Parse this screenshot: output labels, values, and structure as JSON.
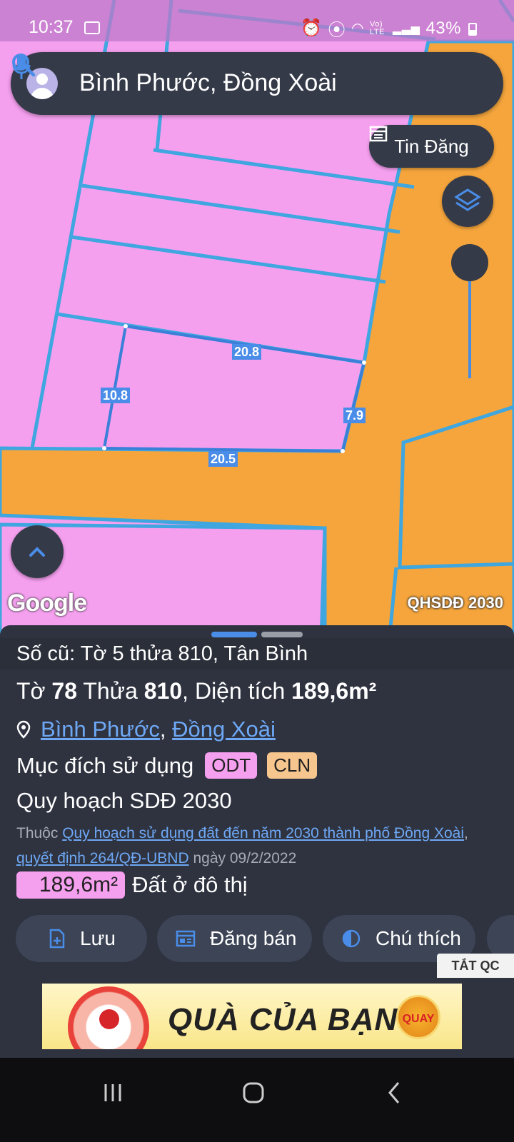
{
  "status_bar": {
    "time": "10:37",
    "network": "Vo) LTE",
    "battery": "43%"
  },
  "search": {
    "value": "Bình Phước, Đồng Xoài"
  },
  "map": {
    "tin_dang_label": "Tin Đăng",
    "google_logo": "Google",
    "layer_label": "QHSDĐ 2030",
    "dimensions": {
      "top": "20.8",
      "left": "10.8",
      "right": "7.9",
      "bottom": "20.5"
    },
    "colors": {
      "residential": "#f59fef",
      "road": "#f5a53c",
      "boundary": "#3fa6e0"
    }
  },
  "sheet": {
    "old_info": "Số cũ: Tờ 5 thửa 810, Tân Bình",
    "to_label": "Tờ",
    "to_value": "78",
    "thua_label": "Thửa",
    "thua_value": "810",
    "dien_tich_label": ", Diện tích",
    "dien_tich_value": "189,6m²",
    "province": "Bình Phước",
    "comma": ",",
    "district": "Đồng Xoài",
    "purpose_label": "Mục đích sử dụng",
    "tags": [
      {
        "label": "ODT",
        "color": "#f59fef"
      },
      {
        "label": "CLN",
        "color": "#f7c58e"
      }
    ],
    "plan_title": "Quy hoạch SDĐ 2030",
    "belongs_prefix": "Thuộc",
    "plan_link": "Quy hoạch sử dụng đất đến năm 2030 thành phố Đồng Xoài",
    "decision_link": "quyết định 264/QĐ-UBND",
    "date_text": "ngày 09/2/2022",
    "area_value": "189,6m²",
    "area_type": "Đất ở đô thị",
    "actions": {
      "save": "Lưu",
      "sell": "Đăng bán",
      "legend": "Chú thích"
    },
    "ad_off": "TẮT QC"
  },
  "ad": {
    "text": "QUÀ CỦA BẠN",
    "button": "QUAY"
  }
}
